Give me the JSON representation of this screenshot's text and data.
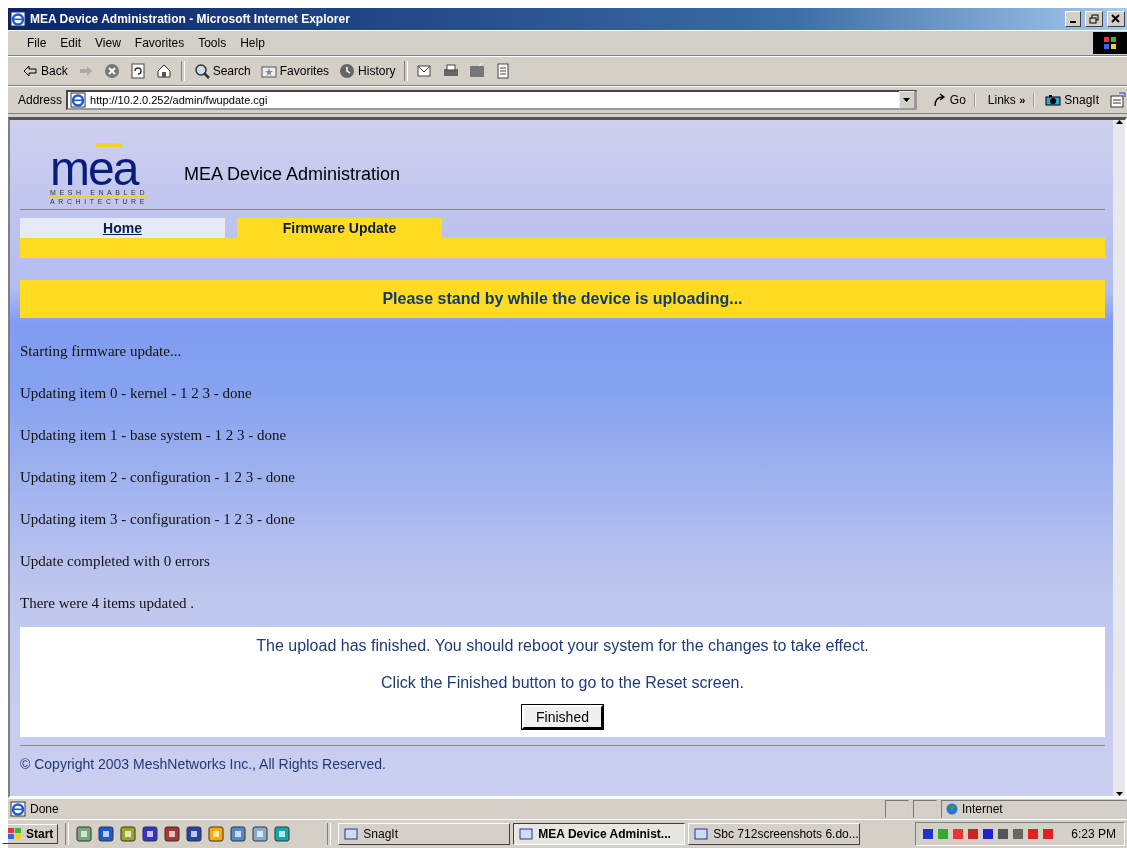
{
  "window": {
    "title": "MEA Device Administration - Microsoft Internet Explorer"
  },
  "menu": [
    "File",
    "Edit",
    "View",
    "Favorites",
    "Tools",
    "Help"
  ],
  "toolbar": [
    {
      "kind": "back",
      "label": "Back"
    },
    {
      "kind": "forward"
    },
    {
      "kind": "stop"
    },
    {
      "kind": "refresh"
    },
    {
      "kind": "home"
    },
    {
      "kind": "search",
      "label": "Search"
    },
    {
      "kind": "favorites",
      "label": "Favorites"
    },
    {
      "kind": "history",
      "label": "History"
    },
    {
      "kind": "mail"
    },
    {
      "kind": "print"
    },
    {
      "kind": "edit"
    },
    {
      "kind": "discuss"
    }
  ],
  "address": {
    "label": "Address",
    "value": "http://10.2.0.252/admin/fwupdate.cgi",
    "go": "Go",
    "links": "Links",
    "links_more": "»",
    "snagit": "SnagIt"
  },
  "page": {
    "logo": {
      "mark": "mea",
      "line1": "MESH ENABLED",
      "line2": "ARCHITECTURE"
    },
    "title": "MEA Device Administration",
    "tabs": [
      {
        "label": "Home",
        "selected": false
      },
      {
        "label": "Firmware Update",
        "selected": true
      }
    ],
    "banner": "Please stand by while the device is uploading...",
    "log": [
      "Starting firmware update...",
      "Updating item 0 - kernel - 1 2 3 - done",
      "Updating item 1 - base system - 1 2 3 - done",
      "Updating item 2 - configuration - 1 2 3 - done",
      "Updating item 3 - configuration - 1 2 3 - done",
      "Update completed with 0 errors",
      "There were 4 items updated ."
    ],
    "notice": [
      "The upload has finished. You should reboot your system for the changes to take effect.",
      "Click the Finished button to go to the Reset screen."
    ],
    "button": "Finished",
    "footer": "© Copyright 2003 MeshNetworks Inc., All Rights Reserved."
  },
  "status_bar": {
    "text": "Done",
    "zone": "Internet"
  },
  "taskbar": {
    "start": "Start",
    "tasks": [
      {
        "label": "SnagIt",
        "selected": false
      },
      {
        "label": "MEA Device Administ...",
        "selected": true
      },
      {
        "label": "Sbc 712screenshots 6.do...",
        "selected": false
      }
    ],
    "clock": "6:23 PM"
  }
}
